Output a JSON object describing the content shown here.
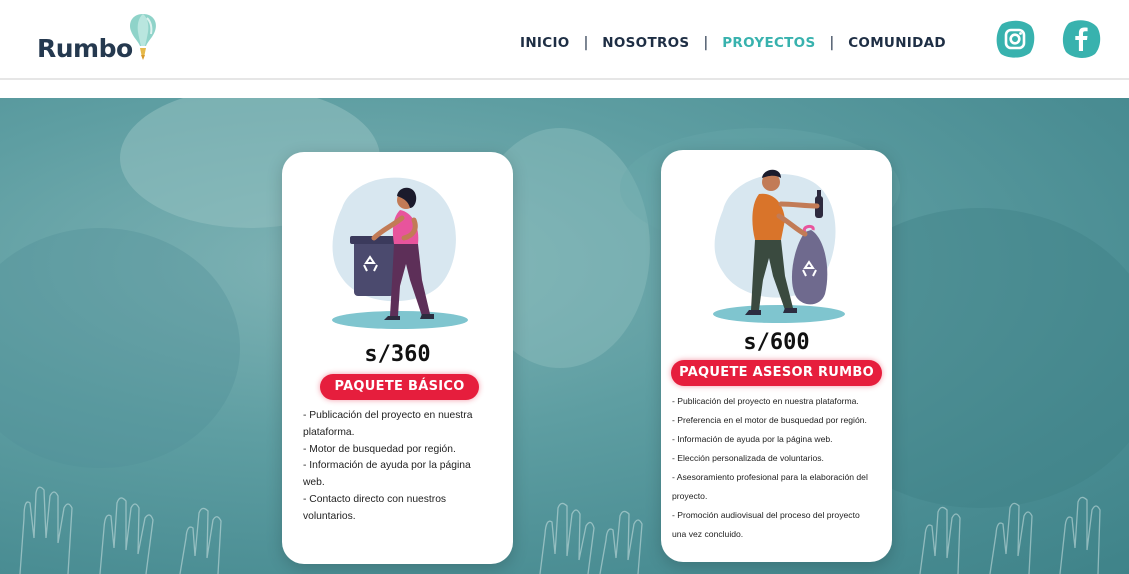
{
  "logo": {
    "text": "Rumbo"
  },
  "nav": {
    "items": [
      {
        "label": "INICIO",
        "active": false
      },
      {
        "label": "NOSOTROS",
        "active": false
      },
      {
        "label": "PROYECTOS",
        "active": true
      },
      {
        "label": "COMUNIDAD",
        "active": false
      }
    ],
    "separator": "|"
  },
  "social": {
    "instagram": "instagram-icon",
    "facebook": "facebook-icon"
  },
  "colors": {
    "accent": "#38b2ae",
    "badge": "#e61e3d",
    "nav_text": "#1e2e44",
    "hero": "#5e9ea2"
  },
  "packages": [
    {
      "price": "s/360",
      "name": "PAQUETE BÁSICO",
      "features": [
        "- Publicación del proyecto en nuestra",
        "plataforma.",
        "- Motor de busquedad por región.",
        "- Información de ayuda por la página",
        "web.",
        "- Contacto directo con nuestros",
        "voluntarios."
      ]
    },
    {
      "price": "s/600",
      "name": "PAQUETE ASESOR RUMBO",
      "features": [
        "- Publicación del proyecto en nuestra plataforma.",
        "- Preferencia en el motor de busquedad por región.",
        "- Información de ayuda por la página web.",
        "- Elección personalizada de voluntarios.",
        "- Asesoramiento profesional para la elaboración del",
        "proyecto.",
        "- Promoción audiovisual del proceso del proyecto",
        "una vez concluido."
      ]
    }
  ]
}
